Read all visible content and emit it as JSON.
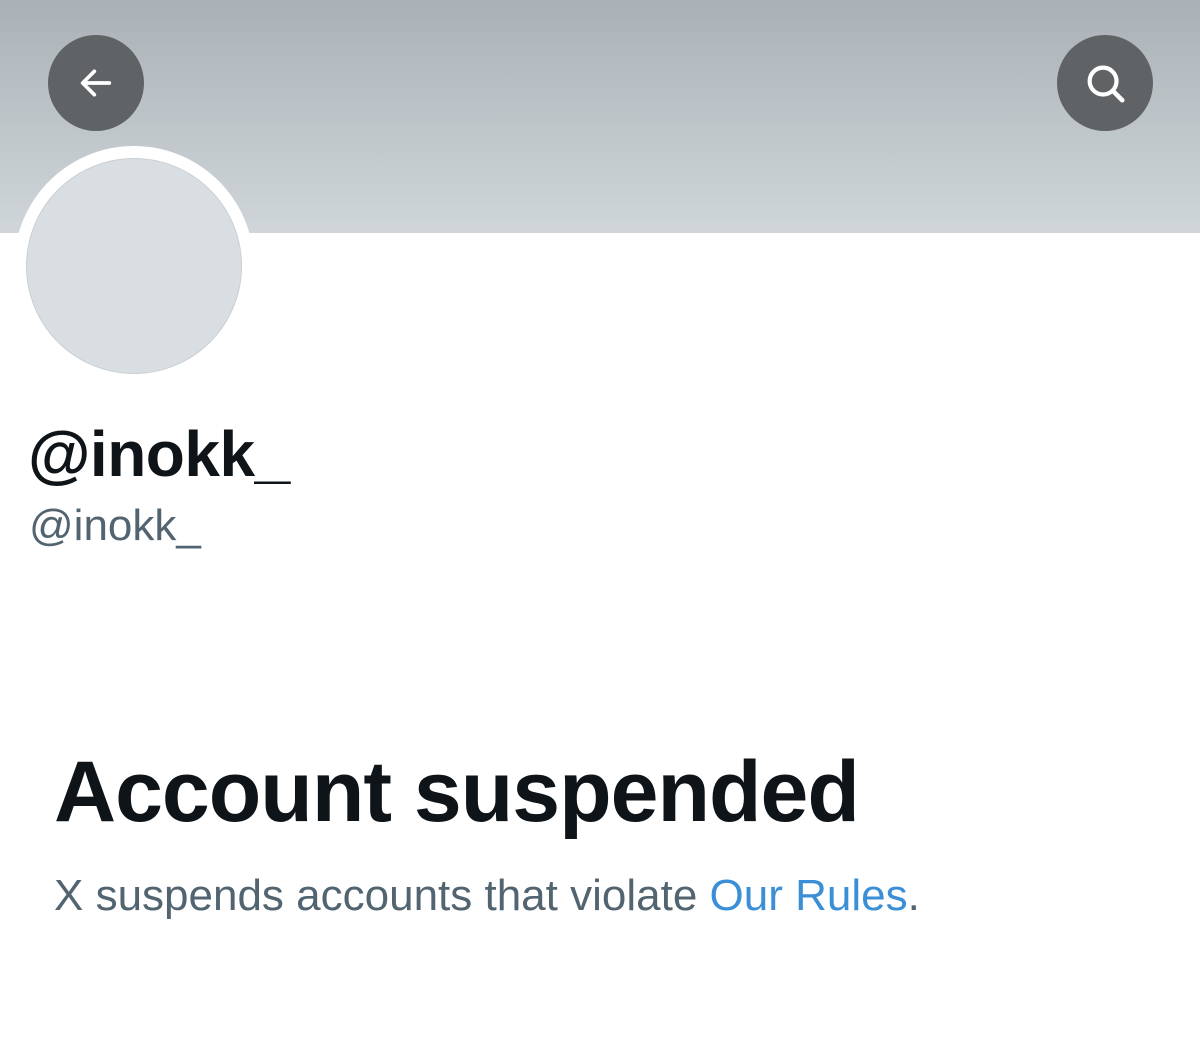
{
  "header": {
    "back_icon": "arrow-left-icon",
    "search_icon": "search-icon"
  },
  "profile": {
    "display_name": "@inokk_",
    "handle": "@inokk_"
  },
  "suspension": {
    "title": "Account suspended",
    "message_prefix": "X suspends accounts that violate ",
    "rules_link_label": "Our Rules",
    "message_suffix": "."
  },
  "colors": {
    "banner": "#bfc6ca",
    "button_bg": "#5f6366",
    "text_primary": "#0f1419",
    "text_secondary": "#536471",
    "link": "#3b8fd6"
  }
}
